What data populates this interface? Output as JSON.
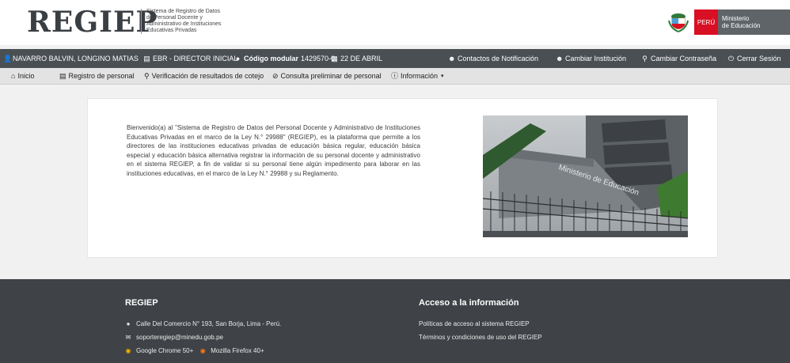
{
  "header": {
    "logo": "REGIEP",
    "description": [
      "Sistema de Registro de Datos",
      "de Personal Docente y",
      "Administrativo de Instituciones",
      "Educativas Privadas"
    ],
    "peru_label": "PERÚ",
    "ministry_label": [
      "Ministerio",
      "de Educación"
    ]
  },
  "userbar": {
    "user_name": "NAVARRO BALVIN, LONGINO MATIAS",
    "role": "EBR - DIRECTOR INICIAL",
    "modular_label": "Código modular",
    "modular_code": "1429570-0",
    "date": "22 DE ABRIL",
    "contacts": "Contactos de Notificación",
    "change_institution": "Cambiar Institución",
    "change_password": "Cambiar Contraseña",
    "logout": "Cerrar Sesión"
  },
  "nav": {
    "home": "Inicio",
    "staff_registry": "Registro de personal",
    "verify_results": "Verificación de resultados de cotejo",
    "preliminary": "Consulta preliminar de personal",
    "info": "Información"
  },
  "main": {
    "welcome_text": "Bienvenido(a) al \"Sistema de Registro de Datos del Personal Docente y Administrativo de Instituciones Educativas Privadas en el marco de la Ley N.° 29988\" (REGIEP), es la plataforma que permite a los directores de las instituciones educativas privadas de educación básica regular, educación básica especial y educación básica alternativa registrar la información de su personal docente y administrativo en el sistema REGIEP, a fin de validar si su personal tiene algún impedimento para laborar en las instituciones educativas, en el marco de la Ley N.° 29988 y su Reglamento.",
    "photo_sign": "Ministerio de Educación"
  },
  "footer": {
    "brand": "REGIEP",
    "address": "Calle Del Comercio N° 193, San Borja, Lima - Perú.",
    "email": "soporteregiep@minedu.gob.pe",
    "browser_chrome": "Google Chrome 50+",
    "browser_firefox": "Mozilla Firefox 40+",
    "access_title": "Acceso a la información",
    "access_policy": "Políticas de acceso al sistema REGIEP",
    "terms": "Términos y condiciones de uso del REGIEP"
  },
  "colors": {
    "header_bg": "#ffffff",
    "userbar_bg": "#4a4f54",
    "nav_bg": "#e3e3e3",
    "footer_bg": "#3f4347",
    "peru_red": "#d91023"
  }
}
